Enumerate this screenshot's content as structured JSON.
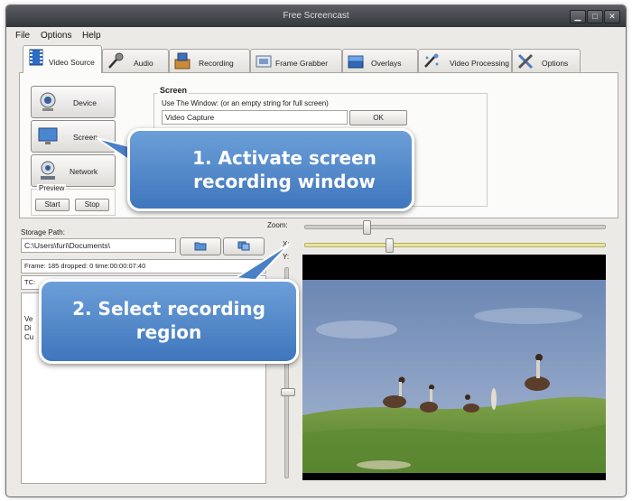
{
  "window": {
    "title": "Free Screencast"
  },
  "menu": [
    "File",
    "Options",
    "Help"
  ],
  "tabs": [
    {
      "label": "Video Source",
      "icon": "film-icon"
    },
    {
      "label": "Audio",
      "icon": "microphone-icon"
    },
    {
      "label": "Recording",
      "icon": "recording-icon"
    },
    {
      "label": "Frame Grabber",
      "icon": "frame-grabber-icon"
    },
    {
      "label": "Overlays",
      "icon": "overlays-icon"
    },
    {
      "label": "Video Processing",
      "icon": "video-processing-icon"
    },
    {
      "label": "Options",
      "icon": "tools-icon"
    }
  ],
  "sources": {
    "device": "Device",
    "screen": "Screen",
    "network": "Network",
    "preview_title": "Preview",
    "start": "Start",
    "stop": "Stop"
  },
  "screen_group": {
    "title": "Screen",
    "hint": "Use The Window: (or an empty string for full screen)",
    "window_value": "Video Capture",
    "ok": "OK"
  },
  "storage": {
    "label": "Storage Path:",
    "path": "C:\\Users\\furi\\Documents\\"
  },
  "status": {
    "frame": "Frame: 185 dropped: 0 time:00:00:07:40",
    "tc_prefix": "TC:",
    "log_lines": [
      "Ve",
      "Di",
      "Cu"
    ]
  },
  "zoom": {
    "zoom_label": "Zoom:",
    "x_label": "X:",
    "y_label": "Y:"
  },
  "callouts": {
    "one": "1. Activate screen recording window",
    "two": "2. Select recording region"
  }
}
